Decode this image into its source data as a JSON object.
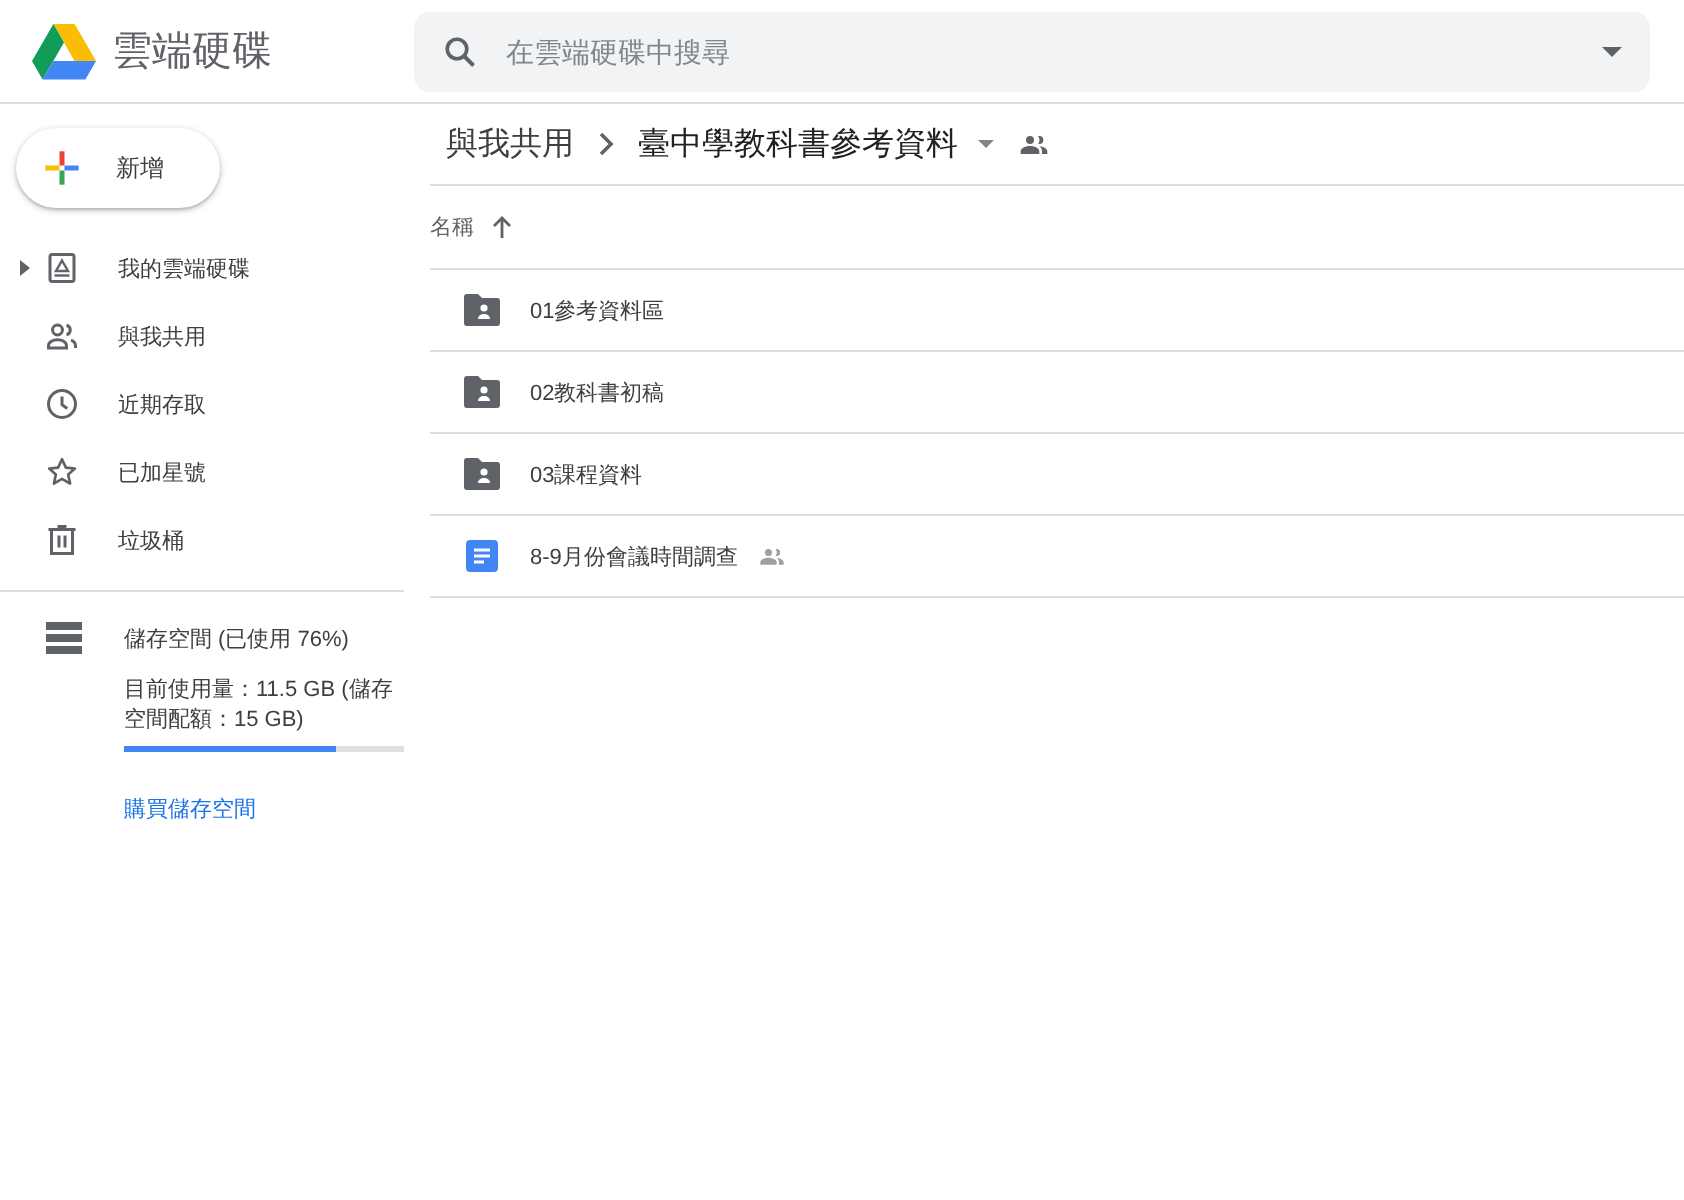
{
  "header": {
    "app_title": "雲端硬碟",
    "search": {
      "placeholder": "在雲端硬碟中搜尋"
    }
  },
  "sidebar": {
    "new_button": "新增",
    "items": [
      {
        "kind": "my-drive",
        "label": "我的雲端硬碟",
        "expanded": false
      },
      {
        "kind": "shared",
        "label": "與我共用"
      },
      {
        "kind": "recent",
        "label": "近期存取"
      },
      {
        "kind": "starred",
        "label": "已加星號"
      },
      {
        "kind": "trash",
        "label": "垃圾桶"
      }
    ],
    "storage": {
      "label": "儲存空間 (已使用 76%)",
      "usage": "目前使用量：11.5 GB (儲存空間配額：15 GB)",
      "level": 0.76,
      "buy_link": "購買儲存空間"
    }
  },
  "main": {
    "breadcrumb": [
      {
        "label": "與我共用"
      },
      {
        "label": "臺中學教科書參考資料"
      }
    ],
    "sort": {
      "label": "名稱",
      "ascending": true
    },
    "files": [
      {
        "kind": "shared-folder",
        "name": "01參考資料區",
        "shared": false
      },
      {
        "kind": "shared-folder",
        "name": "02教科書初稿",
        "shared": false
      },
      {
        "kind": "shared-folder",
        "name": "03課程資料",
        "shared": false
      },
      {
        "kind": "doc",
        "name": "8-9月份會議時間調查",
        "shared": true
      }
    ]
  }
}
